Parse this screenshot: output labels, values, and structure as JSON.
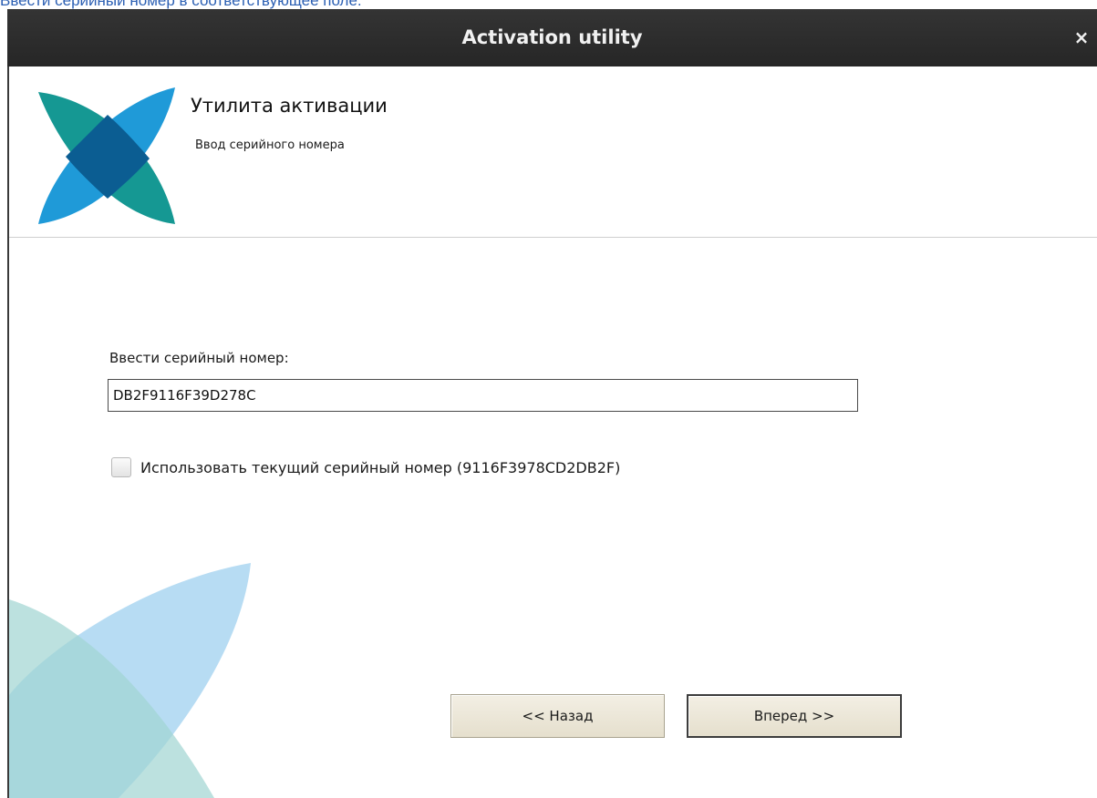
{
  "doc_caption": "Ввести серийный номер в соответствующее поле.",
  "window": {
    "title": "Activation utility",
    "close_glyph": "×"
  },
  "header": {
    "title": "Утилита активации",
    "subtitle": "Ввод серийного номера",
    "logo": "activation-logo-icon"
  },
  "form": {
    "serial_label": "Ввести серийный номер:",
    "serial_value": "DB2F9116F39D278C",
    "use_current_label": "Использовать текущий серийный номер (9116F3978CD2DB2F)",
    "use_current_checked": false
  },
  "buttons": {
    "back_label": "<< Назад",
    "next_label": "Вперед >>"
  },
  "colors": {
    "titlebar": "#2c2c2c",
    "logo_teal": "#159893",
    "logo_blue": "#1f9ad8",
    "logo_overlap": "#0a5a8f",
    "link_text": "#2b5fb3",
    "button_face": "#ece7d8"
  }
}
